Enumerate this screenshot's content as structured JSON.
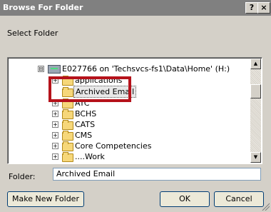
{
  "window": {
    "title": "Browse For Folder",
    "help_glyph": "?",
    "close_glyph": "×"
  },
  "prompt": "Select Folder",
  "tree": {
    "root": {
      "expander": "⊟",
      "icon": "network-drive-icon",
      "label": "E027766 on 'Techsvcs-fs1\\Data\\Home' (H:)"
    },
    "items": [
      {
        "label": "applications",
        "expander": "+",
        "icon": "folder-icon"
      },
      {
        "label": "Archived Email",
        "expander": "",
        "icon": "folder-icon",
        "selected": true
      },
      {
        "label": "ATC",
        "expander": "+",
        "icon": "folder-icon"
      },
      {
        "label": "BCHS",
        "expander": "+",
        "icon": "folder-icon"
      },
      {
        "label": "CATS",
        "expander": "+",
        "icon": "folder-icon"
      },
      {
        "label": "CMS",
        "expander": "+",
        "icon": "folder-icon"
      },
      {
        "label": "Core Competencies",
        "expander": "+",
        "icon": "folder-icon"
      },
      {
        "label": "....Work",
        "expander": "+",
        "icon": "folder-icon"
      }
    ],
    "scroll_up_glyph": "▲",
    "scroll_down_glyph": "▼"
  },
  "folder_field": {
    "label": "Folder:",
    "value": "Archived Email"
  },
  "buttons": {
    "make_new_folder": "Make New Folder",
    "ok": "OK",
    "cancel": "Cancel"
  },
  "colors": {
    "highlight_box": "#b5121b",
    "dialog_bg": "#d4d0c8"
  }
}
